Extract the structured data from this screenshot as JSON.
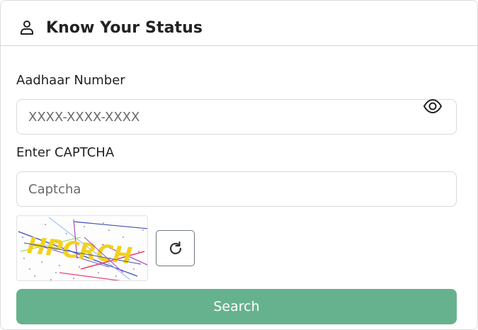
{
  "header": {
    "icon": "person-icon",
    "title": "Know Your Status"
  },
  "form": {
    "aadhaar": {
      "label": "Aadhaar Number",
      "placeholder": "XXXX-XXXX-XXXX",
      "value": "",
      "toggle_icon": "eye-icon"
    },
    "captcha": {
      "label": "Enter CAPTCHA",
      "placeholder": "Captcha",
      "value": "",
      "image_text": "HPCRCH",
      "refresh_icon": "refresh-icon"
    },
    "submit_label": "Search"
  },
  "colors": {
    "primary_button": "#67b28e",
    "captcha_text": "#f2d21a",
    "border": "#d9d9d9"
  }
}
